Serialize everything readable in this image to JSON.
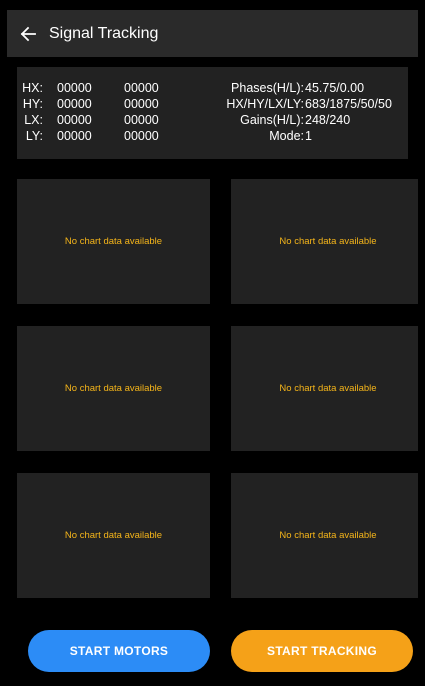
{
  "appbar": {
    "title": "Signal Tracking"
  },
  "readings": [
    {
      "label": "HX:",
      "value1": "00000",
      "value2": "00000"
    },
    {
      "label": "HY:",
      "value1": "00000",
      "value2": "00000"
    },
    {
      "label": "LX:",
      "value1": "00000",
      "value2": "00000"
    },
    {
      "label": "LY:",
      "value1": "00000",
      "value2": "00000"
    }
  ],
  "status": [
    {
      "label": "Phases(H/L):",
      "value": "45.75/0.00"
    },
    {
      "label": "HX/HY/LX/LY:",
      "value": "683/1875/50/50"
    },
    {
      "label": "Gains(H/L):",
      "value": "248/240"
    },
    {
      "label": "Mode:",
      "value": "1"
    }
  ],
  "charts": [
    {
      "empty_text": "No chart data available"
    },
    {
      "empty_text": "No chart data available"
    },
    {
      "empty_text": "No chart data available"
    },
    {
      "empty_text": "No chart data available"
    },
    {
      "empty_text": "No chart data available"
    },
    {
      "empty_text": "No chart data available"
    }
  ],
  "buttons": {
    "start_motors": "START MOTORS",
    "start_tracking": "START TRACKING"
  },
  "colors": {
    "appbar": "#2a2a2a",
    "panel": "#222222",
    "empty_text": "#f5b51a",
    "motors_button": "#2c8cf6",
    "tracking_button": "#f5a118"
  },
  "icons": {
    "back": "arrow-left-icon"
  }
}
